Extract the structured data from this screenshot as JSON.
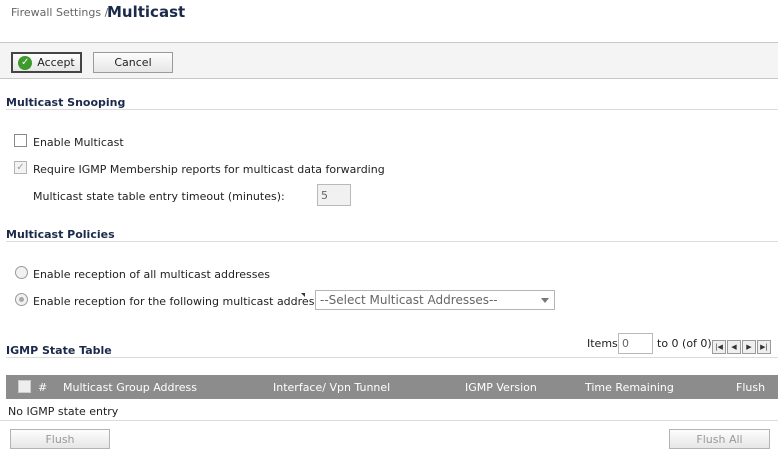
{
  "header": {
    "breadcrumb": "Firewall Settings /",
    "title": "Multicast"
  },
  "toolbar": {
    "accept_label": "Accept",
    "cancel_label": "Cancel"
  },
  "snooping": {
    "title": "Multicast Snooping",
    "enable_multicast_label": "Enable Multicast",
    "enable_multicast_checked": false,
    "require_igmp_label": "Require IGMP Membership reports for multicast data forwarding",
    "require_igmp_checked": true,
    "timeout_label": "Multicast state table entry timeout (minutes):",
    "timeout_value": "5"
  },
  "policies": {
    "title": "Multicast Policies",
    "option_all_label": "Enable reception of all multicast addresses",
    "option_following_label": "Enable reception for the following multicast addresses",
    "selected_option": "following",
    "address_select_value": "--Select Multicast Addresses--"
  },
  "igmp_table": {
    "title": "IGMP State Table",
    "items_label": "Items",
    "items_value": "0",
    "range_text": "to 0 (of 0)",
    "columns": [
      "#",
      "Multicast Group Address",
      "Interface/ Vpn Tunnel",
      "IGMP Version",
      "Time Remaining",
      "Flush"
    ],
    "empty_message": "No IGMP state entry",
    "flush_label": "Flush",
    "flush_all_label": "Flush All"
  },
  "colors": {
    "header_bg": "#8c8c8c",
    "title_color": "#1b2a4a",
    "accept_icon": "#3d9a2c"
  }
}
